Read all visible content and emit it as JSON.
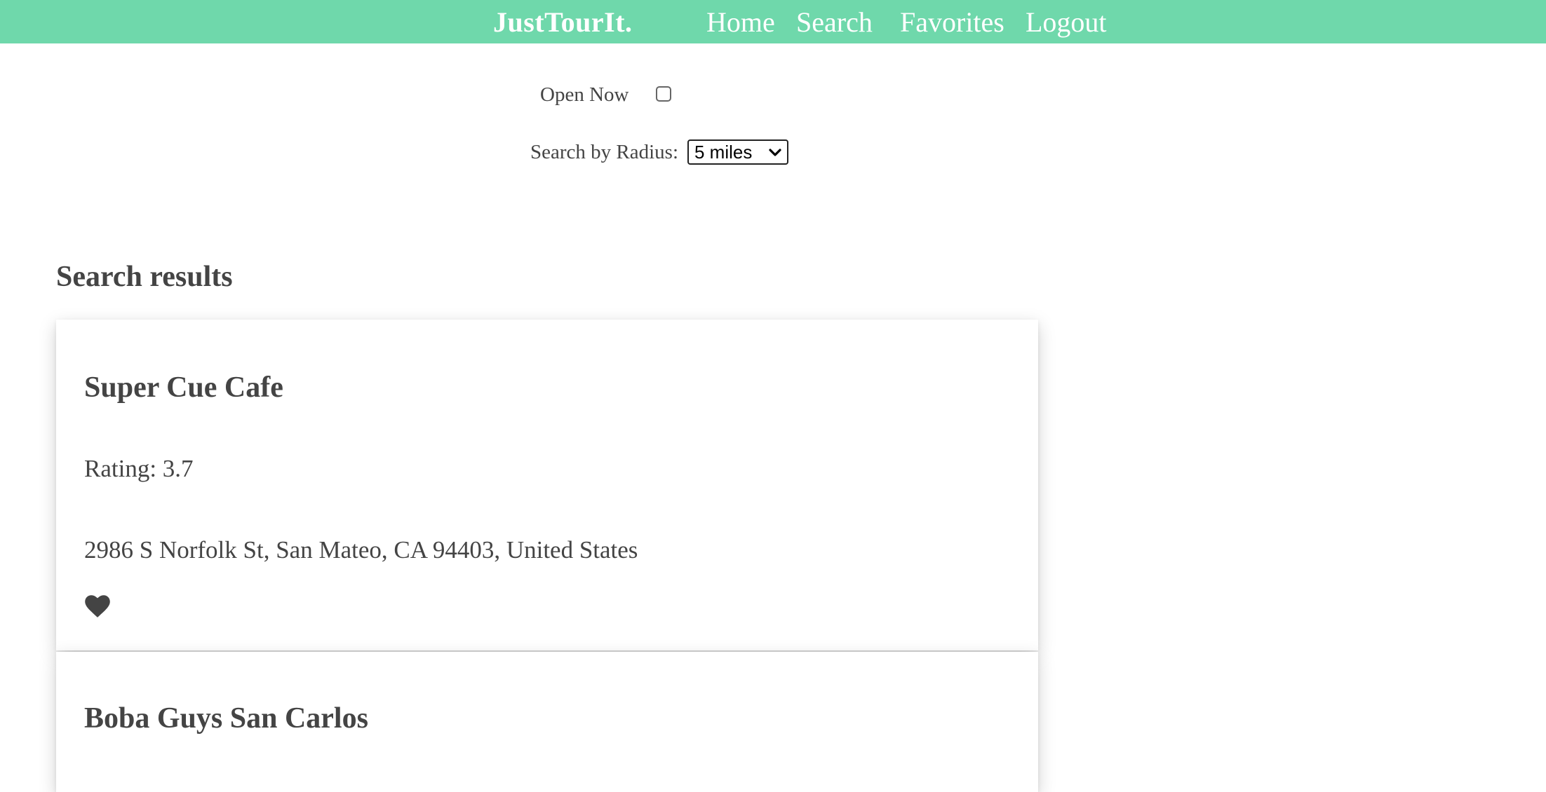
{
  "navbar": {
    "brand": "JustTourIt.",
    "links": {
      "home": "Home",
      "search": "Search",
      "favorites": "Favorites",
      "logout": "Logout"
    },
    "background_color": "#6fd8ab"
  },
  "filters": {
    "open_now_label": "Open Now",
    "open_now_checked": false,
    "radius_label": "Search by Radius:",
    "radius_selected": "5 miles"
  },
  "results": {
    "title": "Search results",
    "items": [
      {
        "name": "Super Cue Cafe",
        "rating": "Rating: 3.7",
        "address": "2986 S Norfolk St, San Mateo, CA 94403, United States",
        "icon": "heart-icon"
      },
      {
        "name": "Boba Guys San Carlos"
      }
    ]
  }
}
